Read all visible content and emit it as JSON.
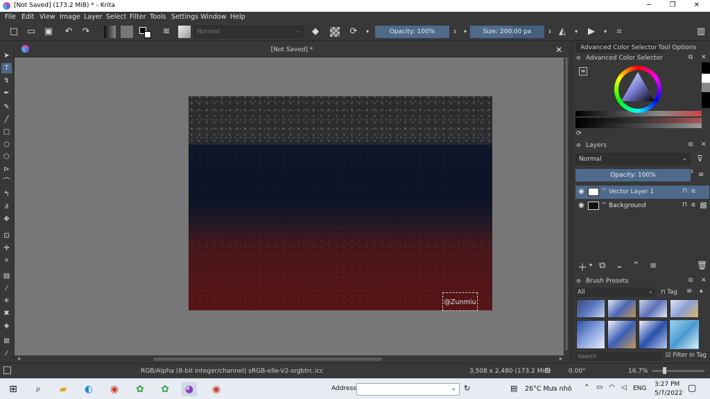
{
  "window": {
    "title": "[Not Saved]  (173.2 MiB)  * - Krita",
    "minimize": "─",
    "maximize": "❐",
    "close": "✕"
  },
  "menu": [
    "File",
    "Edit",
    "View",
    "Image",
    "Layer",
    "Select",
    "Filter",
    "Tools",
    "Settings",
    "Window",
    "Help"
  ],
  "toolbar": {
    "blend_mode": "Normal",
    "opacity": "Opacity: 100%",
    "size": "Size: 200.00 px"
  },
  "document": {
    "tab_title": "[Not Saved]  *",
    "watermark": "@Zunmiu"
  },
  "dock": {
    "tabs": [
      "Advanced Color Selector",
      "Tool Options"
    ],
    "color_selector_title": "Advanced Color Selector",
    "layers_title": "Layers",
    "layers_blend": "Normal",
    "layers_opacity": "Opacity:  100%",
    "layers": [
      {
        "name": "Vector Layer 1",
        "selected": true
      },
      {
        "name": "Background",
        "selected": false
      }
    ],
    "brush_presets_title": "Brush Presets",
    "brush_filter": "All",
    "brush_tag": "Tag",
    "search_placeholder": "Search",
    "filter_in_tag": "Filter in Tag"
  },
  "status": {
    "color_profile": "RGB/Alpha (8-bit integer/channel)  sRGB-elle-V2-srgbtrc.icc",
    "dimensions": "3,508 x 2,480 (173.2 MiB)",
    "rotation": "0.00°",
    "zoom": "16.7%"
  },
  "taskbar": {
    "address_label": "Address",
    "weather": "26°C  Mưa nhỏ",
    "language": "ENG",
    "time": "3:27 PM",
    "date": "5/7/2022"
  },
  "colors": {
    "accent": "#4f6a8b",
    "panel": "#383838",
    "canvas_bg": "#777777"
  }
}
